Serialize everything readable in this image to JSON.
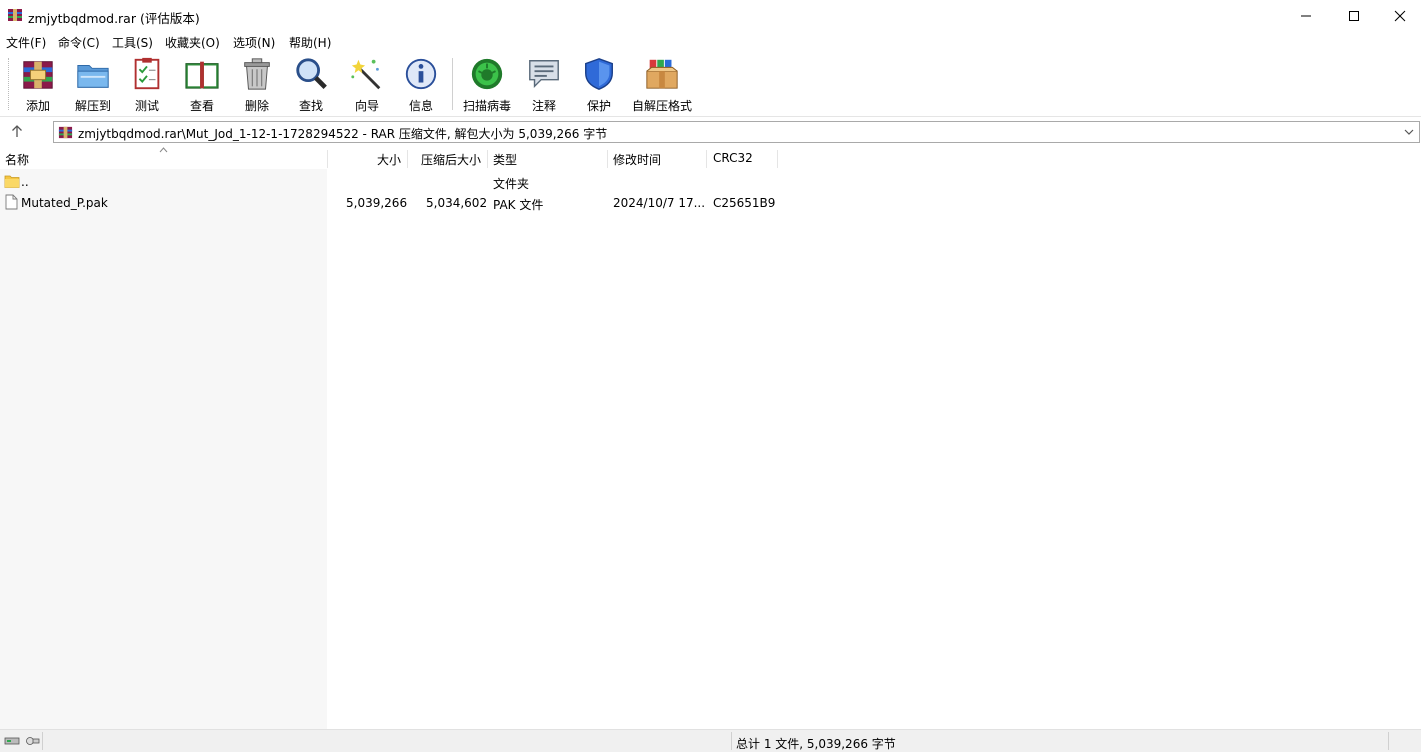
{
  "window": {
    "title": "zmjytbqdmod.rar (评估版本)",
    "icon": "winrar-icon"
  },
  "menu": [
    "文件(F)",
    "命令(C)",
    "工具(S)",
    "收藏夹(O)",
    "选项(N)",
    "帮助(H)"
  ],
  "toolbar": {
    "add": "添加",
    "extract": "解压到",
    "test": "测试",
    "view": "查看",
    "delete": "删除",
    "find": "查找",
    "wizard": "向导",
    "info": "信息",
    "virus_scan": "扫描病毒",
    "comment": "注释",
    "protect": "保护",
    "sfx": "自解压格式"
  },
  "address": {
    "text": "zmjytbqdmod.rar\\Mut_Jod_1-12-1-1728294522 - RAR 压缩文件, 解包大小为 5,039,266 字节"
  },
  "columns": {
    "name": "名称",
    "size": "大小",
    "packed": "压缩后大小",
    "type": "类型",
    "modified": "修改时间",
    "crc": "CRC32"
  },
  "files": [
    {
      "name": "..",
      "size": "",
      "packed": "",
      "type": "文件夹",
      "modified": "",
      "crc": "",
      "icon": "folder-icon"
    },
    {
      "name": "Mutated_P.pak",
      "size": "5,039,266",
      "packed": "5,034,602",
      "type": "PAK 文件",
      "modified": "2024/10/7 17...",
      "crc": "C25651B9",
      "icon": "file-icon"
    }
  ],
  "status": {
    "summary": "总计 1 文件, 5,039,266 字节"
  },
  "colors": {
    "accent": "#0078d7",
    "pane_bg": "#f7f7f7"
  }
}
